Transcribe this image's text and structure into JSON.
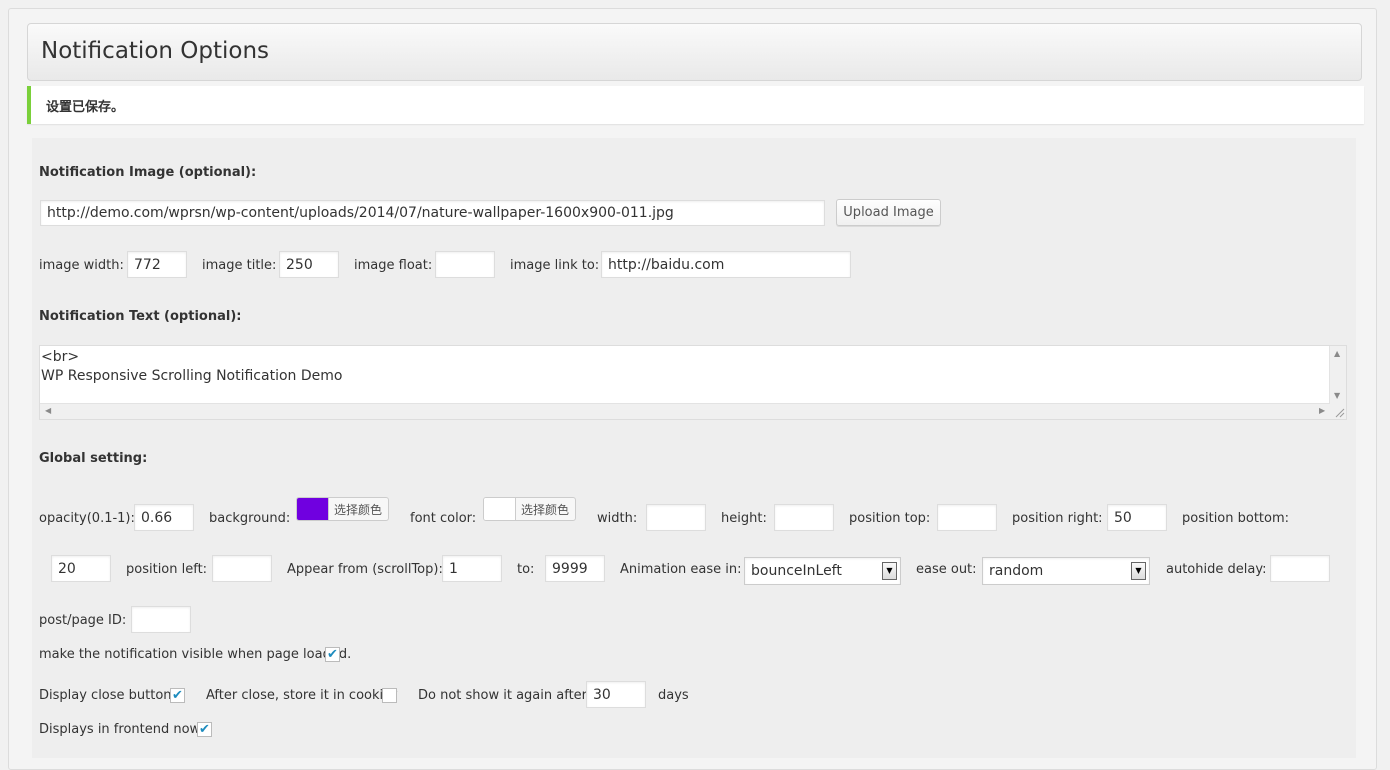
{
  "header": {
    "title": "Notification Options"
  },
  "notice": {
    "text": "设置已保存。"
  },
  "image_section": {
    "heading": "Notification Image (optional):",
    "url_value": "http://demo.com/wprsn/wp-content/uploads/2014/07/nature-wallpaper-1600x900-011.jpg",
    "upload_label": "Upload Image",
    "width_label": "image width:",
    "width_value": "772",
    "title_label": "image title:",
    "title_value": "250",
    "float_label": "image float:",
    "float_value": "",
    "link_label": "image link to:",
    "link_value": "http://baidu.com"
  },
  "text_section": {
    "heading": "Notification Text (optional):",
    "content": "<br>\nWP Responsive Scrolling Notification Demo"
  },
  "global": {
    "heading": "Global setting:",
    "opacity_label": "opacity(0.1-1):",
    "opacity_value": "0.66",
    "background_label": "background:",
    "background_color": "#7000e0",
    "choose_color_label": "选择颜色",
    "font_color_label": "font color:",
    "font_color": "#ffffff",
    "width_label": "width:",
    "width_value": "",
    "height_label": "height:",
    "height_value": "",
    "pos_top_label": "position top:",
    "pos_top_value": "",
    "pos_right_label": "position right:",
    "pos_right_value": "50",
    "pos_bottom_label": "position bottom:",
    "pos_bottom_value": "20",
    "pos_left_label": "position left:",
    "pos_left_value": "",
    "appear_from_label": "Appear from (scrollTop):",
    "appear_from_value": "1",
    "to_label": "to:",
    "to_value": "9999",
    "ease_in_label": "Animation ease in:",
    "ease_in_value": "bounceInLeft",
    "ease_out_label": "ease out:",
    "ease_out_value": "random",
    "autohide_label": "autohide delay:",
    "autohide_value": "",
    "post_id_label": "post/page ID:",
    "post_id_value": "",
    "visible_on_load_label": "make the notification visible when page loaded.",
    "visible_on_load_checked": true,
    "close_button_label": "Display close button?",
    "close_button_checked": true,
    "cookie_label": "After close, store it in cookie?",
    "cookie_checked": false,
    "not_show_label": "Do not show it again after:",
    "not_show_value": "30",
    "days_label": "days",
    "frontend_label": "Displays in frontend now?",
    "frontend_checked": true
  },
  "icons": {
    "check": "✔",
    "arrow_up": "▲",
    "arrow_down": "▼",
    "arrow_left": "◀",
    "arrow_right": "▶"
  }
}
